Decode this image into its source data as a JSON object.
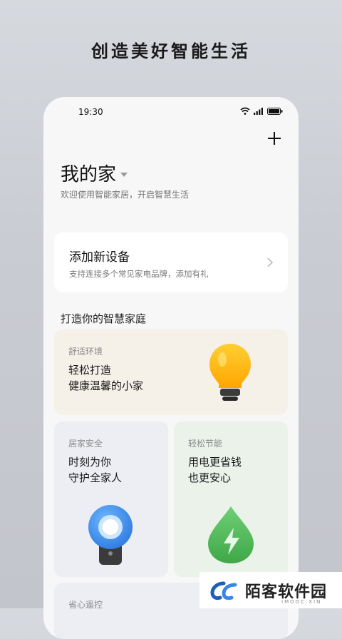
{
  "headline": "创造美好智能生活",
  "status": {
    "time": "19:30"
  },
  "home": {
    "title": "我的家",
    "subtitle": "欢迎使用智能家居，开启智慧生活"
  },
  "add_device": {
    "title": "添加新设备",
    "subtitle": "支持连接多个常见家电品牌，添加有礼"
  },
  "section_title": "打造你的智慧家庭",
  "cards": [
    {
      "tag": "舒适环境",
      "lines": [
        "轻松打造",
        "健康温馨的小家"
      ],
      "icon": "lightbulb-icon"
    },
    {
      "tag": "居家安全",
      "lines": [
        "时刻为你",
        "守护全家人"
      ],
      "icon": "security-camera-icon"
    },
    {
      "tag": "轻松节能",
      "lines": [
        "用电更省钱",
        "也更安心"
      ],
      "icon": "energy-drop-icon"
    },
    {
      "tag": "省心遥控"
    }
  ],
  "watermark": {
    "text": "陌客软件园",
    "url": "IMOOC.XIN"
  },
  "colors": {
    "bulb": "#ffb300",
    "camera": "#3a86e8",
    "energy": "#4caf50"
  }
}
